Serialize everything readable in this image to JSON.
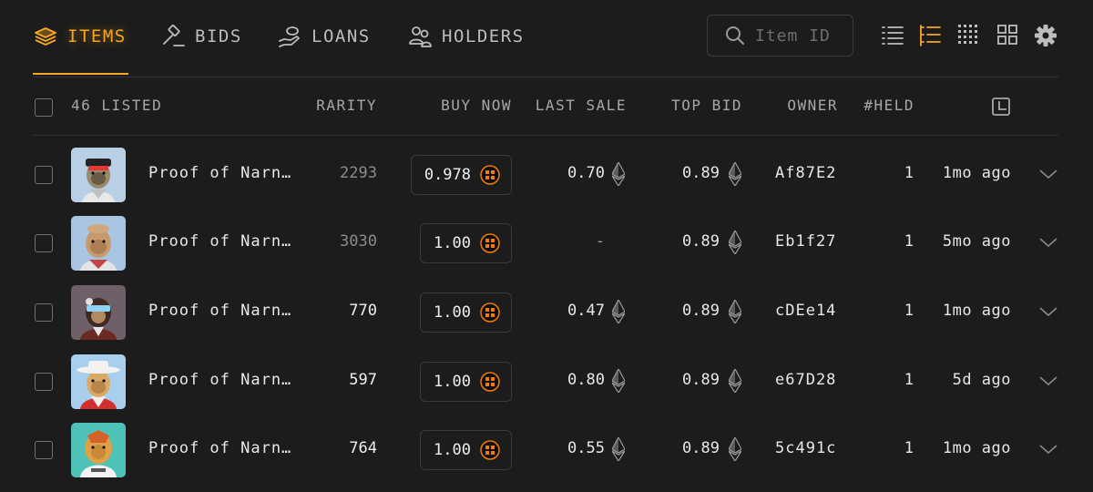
{
  "nav": {
    "tabs": [
      {
        "label": "ITEMS",
        "icon": "layers-icon",
        "active": true
      },
      {
        "label": "BIDS",
        "icon": "gavel-icon",
        "active": false
      },
      {
        "label": "LOANS",
        "icon": "hand-coin-icon",
        "active": false
      },
      {
        "label": "HOLDERS",
        "icon": "users-icon",
        "active": false
      }
    ]
  },
  "search": {
    "placeholder": "Item ID",
    "value": ""
  },
  "views": [
    "list-view-icon",
    "detailed-list-view-icon",
    "dense-grid-view-icon",
    "grid-view-icon",
    "gear-icon"
  ],
  "colors": {
    "accent": "#f5a623",
    "background": "#1c1c1c",
    "coin": "#f57c00"
  },
  "table": {
    "listed_label": "46 LISTED",
    "headers": {
      "rarity": "RARITY",
      "buy_now": "BUY NOW",
      "last_sale": "LAST SALE",
      "top_bid": "TOP BID",
      "owner": "OWNER",
      "held": "#HELD"
    },
    "rows": [
      {
        "name": "Proof of Narn…",
        "rarity": "2293",
        "buy_now": "0.978",
        "last_sale": "0.70",
        "top_bid": "0.89",
        "owner": "Af87E2",
        "held": "1",
        "time": "1mo ago"
      },
      {
        "name": "Proof of Narn…",
        "rarity": "3030",
        "buy_now": "1.00",
        "last_sale": "-",
        "top_bid": "0.89",
        "owner": "Eb1f27",
        "held": "1",
        "time": "5mo ago"
      },
      {
        "name": "Proof of Narn…",
        "rarity": "770",
        "buy_now": "1.00",
        "last_sale": "0.47",
        "top_bid": "0.89",
        "owner": "cDEe14",
        "held": "1",
        "time": "1mo ago"
      },
      {
        "name": "Proof of Narn…",
        "rarity": "597",
        "buy_now": "1.00",
        "last_sale": "0.80",
        "top_bid": "0.89",
        "owner": "e67D28",
        "held": "1",
        "time": "5d ago"
      },
      {
        "name": "Proof of Narn…",
        "rarity": "764",
        "buy_now": "1.00",
        "last_sale": "0.55",
        "top_bid": "0.89",
        "owner": "5c491c",
        "held": "1",
        "time": "1mo ago"
      }
    ]
  }
}
